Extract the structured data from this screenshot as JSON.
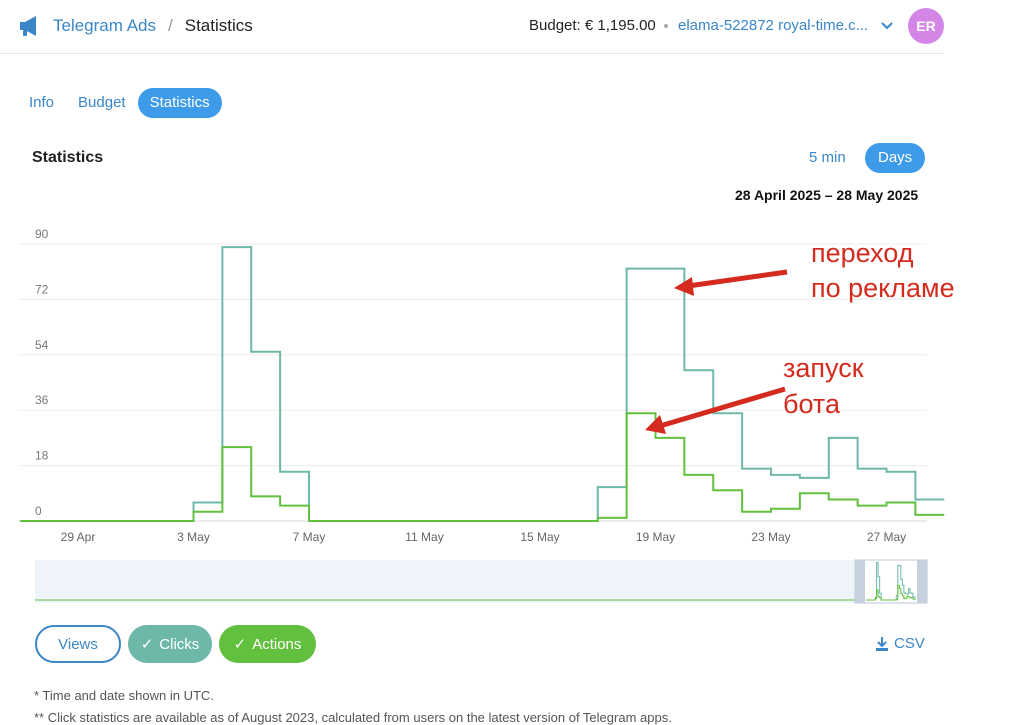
{
  "header": {
    "app_name": "Telegram Ads",
    "separator": "/",
    "page_name": "Statistics",
    "budget": "Budget: € 1,195.00",
    "account": "elama-522872 royal-time.c...",
    "avatar_initials": "ER",
    "avatar_color": "#d486e6"
  },
  "tabs": [
    {
      "label": "Info",
      "active": false
    },
    {
      "label": "Budget",
      "active": false
    },
    {
      "label": "Statistics",
      "active": true
    }
  ],
  "stats": {
    "title": "Statistics",
    "interval_5min": "5 min",
    "interval_days": "Days",
    "date_range": "28 April 2025 – 28 May 2025"
  },
  "chart_data": {
    "type": "line",
    "step": true,
    "x_tick_labels": [
      "29 Apr",
      "3 May",
      "7 May",
      "11 May",
      "15 May",
      "19 May",
      "23 May",
      "27 May"
    ],
    "y_ticks": [
      0,
      18,
      36,
      54,
      72,
      90
    ],
    "ylim": [
      0,
      90
    ],
    "grid": true,
    "x": [
      "28 Apr",
      "29 Apr",
      "30 Apr",
      "1 May",
      "2 May",
      "3 May",
      "4 May",
      "5 May",
      "6 May",
      "7 May",
      "8 May",
      "9 May",
      "10 May",
      "11 May",
      "12 May",
      "13 May",
      "14 May",
      "15 May",
      "16 May",
      "17 May",
      "18 May",
      "19 May",
      "20 May",
      "21 May",
      "22 May",
      "23 May",
      "24 May",
      "25 May",
      "26 May",
      "27 May",
      "28 May"
    ],
    "series": [
      {
        "name": "Views",
        "visible": false,
        "color": "#3d86c6",
        "values": []
      },
      {
        "name": "Clicks",
        "visible": true,
        "color": "#6db8a8",
        "values": [
          0,
          0,
          0,
          0,
          0,
          0,
          6,
          89,
          55,
          16,
          0,
          0,
          0,
          0,
          0,
          0,
          0,
          0,
          0,
          0,
          11,
          82,
          82,
          49,
          35,
          17,
          15,
          14,
          27,
          17,
          16,
          7,
          7
        ]
      },
      {
        "name": "Actions",
        "visible": true,
        "color": "#62c03f",
        "values": [
          0,
          0,
          0,
          0,
          0,
          0,
          3,
          24,
          8,
          5,
          0,
          0,
          0,
          0,
          0,
          0,
          0,
          0,
          0,
          0,
          1,
          35,
          27,
          15,
          10,
          3,
          4,
          9,
          7,
          5,
          6,
          2,
          2
        ]
      }
    ],
    "annotations": [
      {
        "lines": [
          "переход",
          "по рекламе"
        ],
        "color": "#d42b1e"
      },
      {
        "lines": [
          "запуск",
          "бота"
        ],
        "color": "#d42b1e"
      }
    ]
  },
  "legend": {
    "views": "Views",
    "clicks": "Clicks",
    "actions": "Actions",
    "csv": "CSV"
  },
  "notes": {
    "time_note": "* Time and date shown in UTC.",
    "click_note": "** Click statistics are available as of August 2023, calculated from users on the latest version of Telegram apps."
  }
}
